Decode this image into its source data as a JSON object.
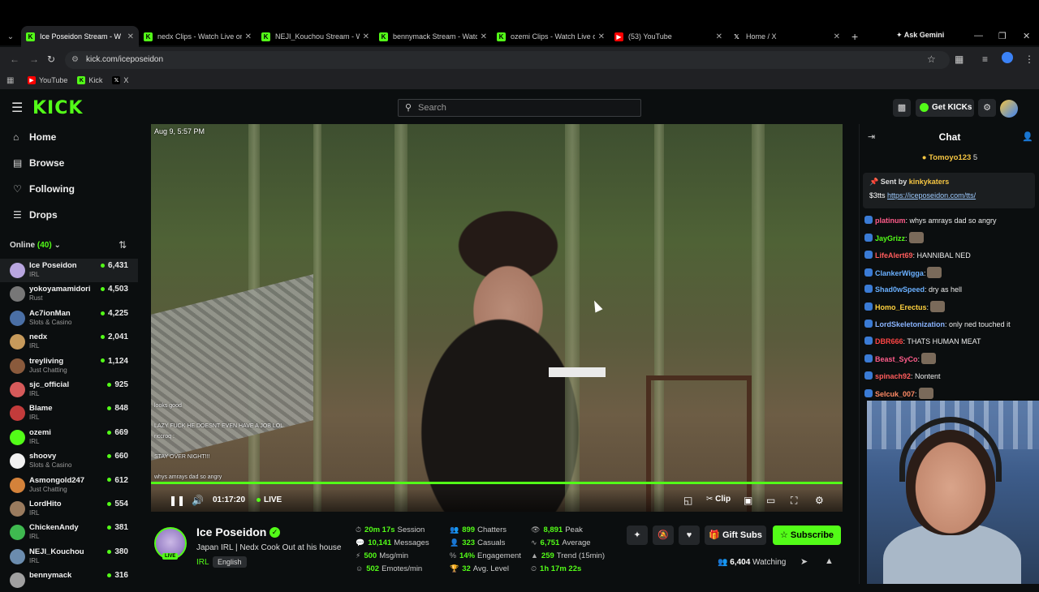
{
  "browser": {
    "tabs": [
      {
        "label": "Ice Poseidon Stream - W",
        "favicon": "K",
        "active": true
      },
      {
        "label": "nedx Clips - Watch Live on",
        "favicon": "K",
        "active": false
      },
      {
        "label": "NEJI_Kouchou Stream - Wa",
        "favicon": "K",
        "active": false
      },
      {
        "label": "bennymack Stream - Watch",
        "favicon": "K",
        "active": false
      },
      {
        "label": "ozemi Clips - Watch Live o",
        "favicon": "K",
        "active": false
      },
      {
        "label": "(53) YouTube",
        "favicon": "YT",
        "active": false
      },
      {
        "label": "Home / X",
        "favicon": "X",
        "active": false
      }
    ],
    "ask_label": "Ask Gemini",
    "url": "kick.com/iceposeidon",
    "bookmarks": [
      {
        "label": "YouTube",
        "favicon": "YT"
      },
      {
        "label": "Kick",
        "favicon": "K"
      },
      {
        "label": "X",
        "favicon": "X"
      }
    ]
  },
  "header": {
    "logo": "KICK",
    "search_placeholder": "Search",
    "get_kicks": "Get KICKs"
  },
  "sidebar": {
    "nav": [
      {
        "label": "Home",
        "icon": "home-icon"
      },
      {
        "label": "Browse",
        "icon": "browse-icon"
      },
      {
        "label": "Following",
        "icon": "heart-icon"
      },
      {
        "label": "Drops",
        "icon": "drops-icon"
      }
    ],
    "online_label": "Online",
    "online_count": "(40)",
    "channels": [
      {
        "name": "Ice Poseidon",
        "category": "IRL",
        "viewers": "6,431",
        "color": "#b9a6e0",
        "selected": true
      },
      {
        "name": "yokoyamamidori",
        "category": "Rust",
        "viewers": "4,503",
        "color": "#777777"
      },
      {
        "name": "Ac7ionMan",
        "category": "Slots & Casino",
        "viewers": "4,225",
        "color": "#4a6fa5"
      },
      {
        "name": "nedx",
        "category": "IRL",
        "viewers": "2,041",
        "color": "#c79a5b"
      },
      {
        "name": "treyliving",
        "category": "Just Chatting",
        "viewers": "1,124",
        "color": "#8a5a3c"
      },
      {
        "name": "sjc_official",
        "category": "IRL",
        "viewers": "925",
        "color": "#d65a5a"
      },
      {
        "name": "Blame",
        "category": "IRL",
        "viewers": "848",
        "color": "#c23b3b"
      },
      {
        "name": "ozemi",
        "category": "IRL",
        "viewers": "669",
        "color": "#53fc18"
      },
      {
        "name": "shoovy",
        "category": "Slots & Casino",
        "viewers": "660",
        "color": "#f2f2f2"
      },
      {
        "name": "Asmongold247",
        "category": "Just Chatting",
        "viewers": "612",
        "color": "#d4823a"
      },
      {
        "name": "LordHito",
        "category": "IRL",
        "viewers": "554",
        "color": "#9a7b5e"
      },
      {
        "name": "ChickenAndy",
        "category": "IRL",
        "viewers": "381",
        "color": "#3fb950"
      },
      {
        "name": "NEJI_Kouchou",
        "category": "IRL",
        "viewers": "380",
        "color": "#6b8cae"
      },
      {
        "name": "bennymack",
        "category": "",
        "viewers": "316",
        "color": "#a0a0a0"
      }
    ]
  },
  "player": {
    "timestamp": "Aug 9, 5:57 PM",
    "time": "01:17:20",
    "live_label": "LIVE",
    "clip_label": "Clip",
    "overlay_chat": [
      {
        "user": "",
        "text": "looks good"
      },
      {
        "user": "",
        "text": ""
      },
      {
        "user": "",
        "text": "LAZY FUCK HE DOESNT EVEN HAVE A JOB LOL"
      },
      {
        "user": "",
        "text": "riccroq :"
      },
      {
        "user": "",
        "text": ""
      },
      {
        "user": "",
        "text": "STAY OVER NIGHT!!!"
      },
      {
        "user": "",
        "text": ""
      },
      {
        "user": "",
        "text": "whys amrays dad so angry"
      }
    ]
  },
  "channel": {
    "name": "Ice Poseidon",
    "title": "Japan IRL | Nedx Cook Out at his house",
    "category": "IRL",
    "language": "English",
    "live_badge": "LIVE",
    "stats": [
      {
        "value": "20m 17s",
        "label": "Session"
      },
      {
        "value": "10,141",
        "label": "Messages"
      },
      {
        "value": "500",
        "label": "Msg/min"
      },
      {
        "value": "502",
        "label": "Emotes/min"
      },
      {
        "value": "899",
        "label": "Chatters"
      },
      {
        "value": "323",
        "label": "Casuals"
      },
      {
        "value": "14%",
        "label": "Engagement"
      },
      {
        "value": "32",
        "label": "Avg. Level"
      },
      {
        "value": "8,891",
        "label": "Peak"
      },
      {
        "value": "6,751",
        "label": "Average"
      },
      {
        "value": "259",
        "label": "Trend (15min)"
      },
      {
        "value": "1h 17m 22s",
        "label": ""
      }
    ],
    "gift_label": "Gift Subs",
    "subscribe_label": "Subscribe",
    "watching_count": "6,404",
    "watching_label": "Watching"
  },
  "chat": {
    "title": "Chat",
    "top_gifter": "Tomoyo123",
    "top_gifter_count": "5",
    "pinned_prefix": "Sent by",
    "pinned_user": "kinkykaters",
    "pinned_text": "$3tts",
    "pinned_link": "https://iceposeidon.com/tts/",
    "messages": [
      {
        "user": "platinum",
        "text": ": whys amrays dad so angry",
        "color": "#ff5c8a",
        "emote": false
      },
      {
        "user": "JayGrizz",
        "text": ":",
        "color": "#53fc18",
        "emote": true
      },
      {
        "user": "LifeAlert69",
        "text": ": HANNIBAL NED",
        "color": "#ff5c5c",
        "emote": false
      },
      {
        "user": "ClankerWigga",
        "text": ":",
        "color": "#6ab0ff",
        "emote": true
      },
      {
        "user": "Shad0wSpeed",
        "text": ": dry as hell",
        "color": "#6ab0ff",
        "emote": false
      },
      {
        "user": "Homo_Erectus",
        "text": ":",
        "color": "#ffd23f",
        "emote": true
      },
      {
        "user": "LordSkeletonization",
        "text": ": only ned touched it",
        "color": "#8ab4ff",
        "emote": false
      },
      {
        "user": "DBR666",
        "text": ": THATS HUMAN MEAT",
        "color": "#ff4545",
        "emote": false
      },
      {
        "user": "Beast_SyCo",
        "text": ":",
        "color": "#ff5c8a",
        "emote": true
      },
      {
        "user": "spinach92",
        "text": ": Nontent",
        "color": "#ff5c5c",
        "emote": false
      },
      {
        "user": "Selcuk_007",
        "text": ":",
        "color": "#ff8a65",
        "emote": true
      }
    ]
  }
}
